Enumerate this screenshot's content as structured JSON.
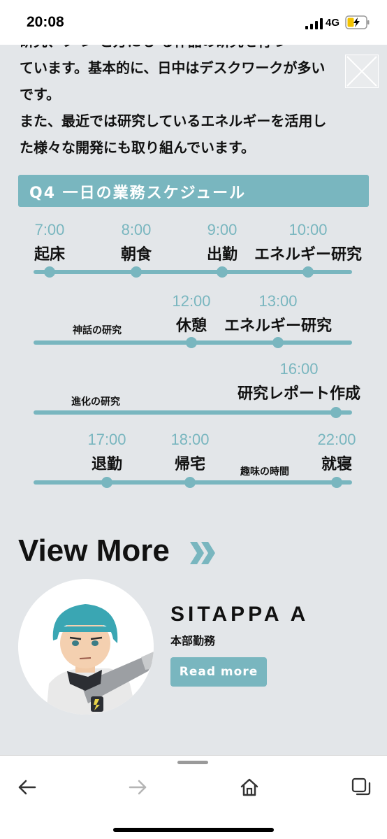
{
  "status_bar": {
    "time": "20:08",
    "network": "4G"
  },
  "article": {
    "lines": [
      "研究、フ  ン  と方にも  る作品の研究を行っ",
      "ています。基本的に、日中はデスクワークが多い",
      "です。",
      "また、最近では研究しているエネルギーを活用し",
      "た様々な開発にも取り組んでいます。"
    ]
  },
  "section_header": "Q4 一日の業務スケジュール",
  "schedule": {
    "row1": [
      {
        "time": "7:00",
        "activity": "起床"
      },
      {
        "time": "8:00",
        "activity": "朝食"
      },
      {
        "time": "9:00",
        "activity": "出勤"
      },
      {
        "time": "10:00",
        "activity": "エネルギー研究"
      }
    ],
    "row2": {
      "note": "神話の研究",
      "items": [
        {
          "time": "12:00",
          "activity": "休憩"
        },
        {
          "time": "13:00",
          "activity": "エネルギー研究"
        }
      ]
    },
    "row3": {
      "note": "進化の研究",
      "items": [
        {
          "time": "16:00",
          "activity": "研究レポート作成"
        }
      ]
    },
    "row4": {
      "note": "趣味の時間",
      "items": [
        {
          "time": "17:00",
          "activity": "退勤"
        },
        {
          "time": "18:00",
          "activity": "帰宅"
        },
        {
          "time": "22:00",
          "activity": "就寝"
        }
      ]
    }
  },
  "view_more": {
    "title": "View More",
    "person": {
      "name": "SITAPPA A",
      "department": "本部勤務"
    },
    "button_label": "Read more"
  },
  "colors": {
    "accent": "#79b6bf",
    "background": "#e3e6e9",
    "text": "#111111"
  },
  "icons": [
    "back-arrow-icon",
    "forward-arrow-icon",
    "home-icon",
    "tabs-icon",
    "close-icon",
    "double-chevron-right-icon"
  ]
}
